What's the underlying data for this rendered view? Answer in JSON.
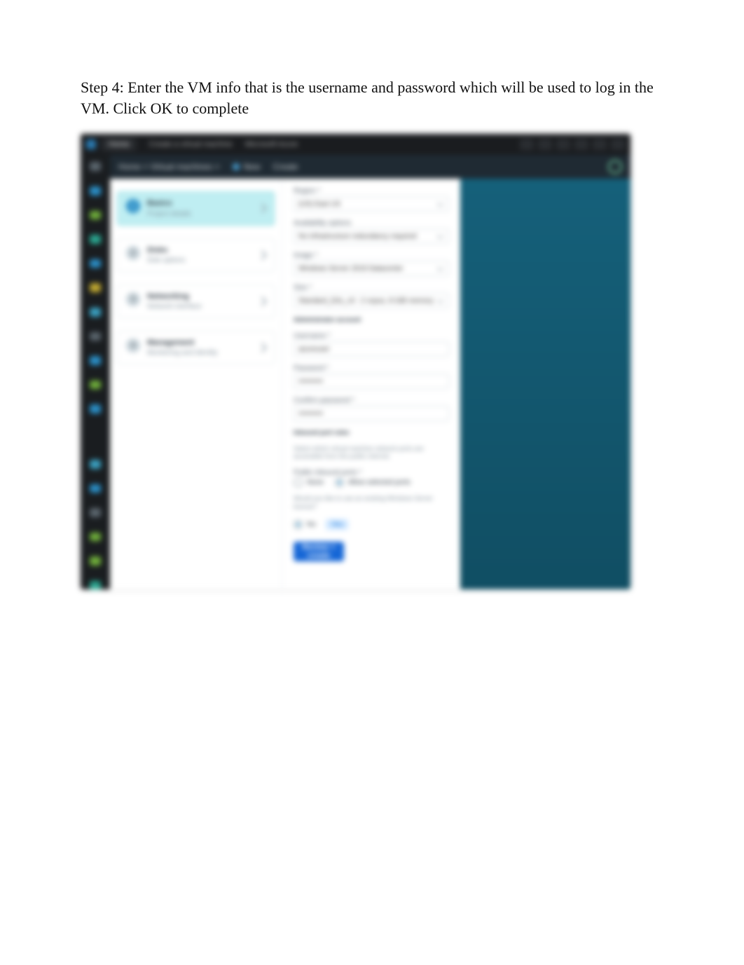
{
  "instruction": "Step 4: Enter the VM info that is the username and password which will be used to log in the VM. Click OK to complete",
  "titlebar": {
    "app": "Azure Portal",
    "tab": "Home",
    "path": "Create a virtual machine",
    "extra": "Microsoft Azure"
  },
  "breadcrumb": {
    "trail": "Home > Virtual machines >",
    "pill1": "New",
    "pill2": "Create"
  },
  "steps": [
    {
      "num": "1",
      "title": "Basics",
      "sub": "Project details",
      "active": true
    },
    {
      "num": "2",
      "title": "Disks",
      "sub": "Disk options",
      "active": false
    },
    {
      "num": "3",
      "title": "Networking",
      "sub": "Network interface",
      "active": false
    },
    {
      "num": "4",
      "title": "Management",
      "sub": "Monitoring and identity",
      "active": false
    }
  ],
  "form": {
    "region_label": "Region *",
    "region_value": "(US) East US",
    "availability_label": "Availability options",
    "availability_value": "No infrastructure redundancy required",
    "image_label": "Image *",
    "image_value": "Windows Server 2019 Datacenter",
    "size_label": "Size *",
    "size_value": "Standard_D2s_v3 - 2 vcpus, 8 GiB memory",
    "admin_header": "Administrator account",
    "username_label": "Username *",
    "username_value": "azureuser",
    "password_label": "Password *",
    "password_value": "••••••••••",
    "confirm_label": "Confirm password *",
    "confirm_value": "••••••••••",
    "inbound_header": "Inbound port rules",
    "inbound_hint": "Select which virtual machine network ports are accessible from the public internet.",
    "ports_label": "Public inbound ports *",
    "ports_none": "None",
    "ports_allow": "Allow selected ports",
    "license_hint": "Would you like to use an existing Windows Server license?",
    "license_no": "No",
    "license_yes": "Yes",
    "button": "Review + create"
  }
}
